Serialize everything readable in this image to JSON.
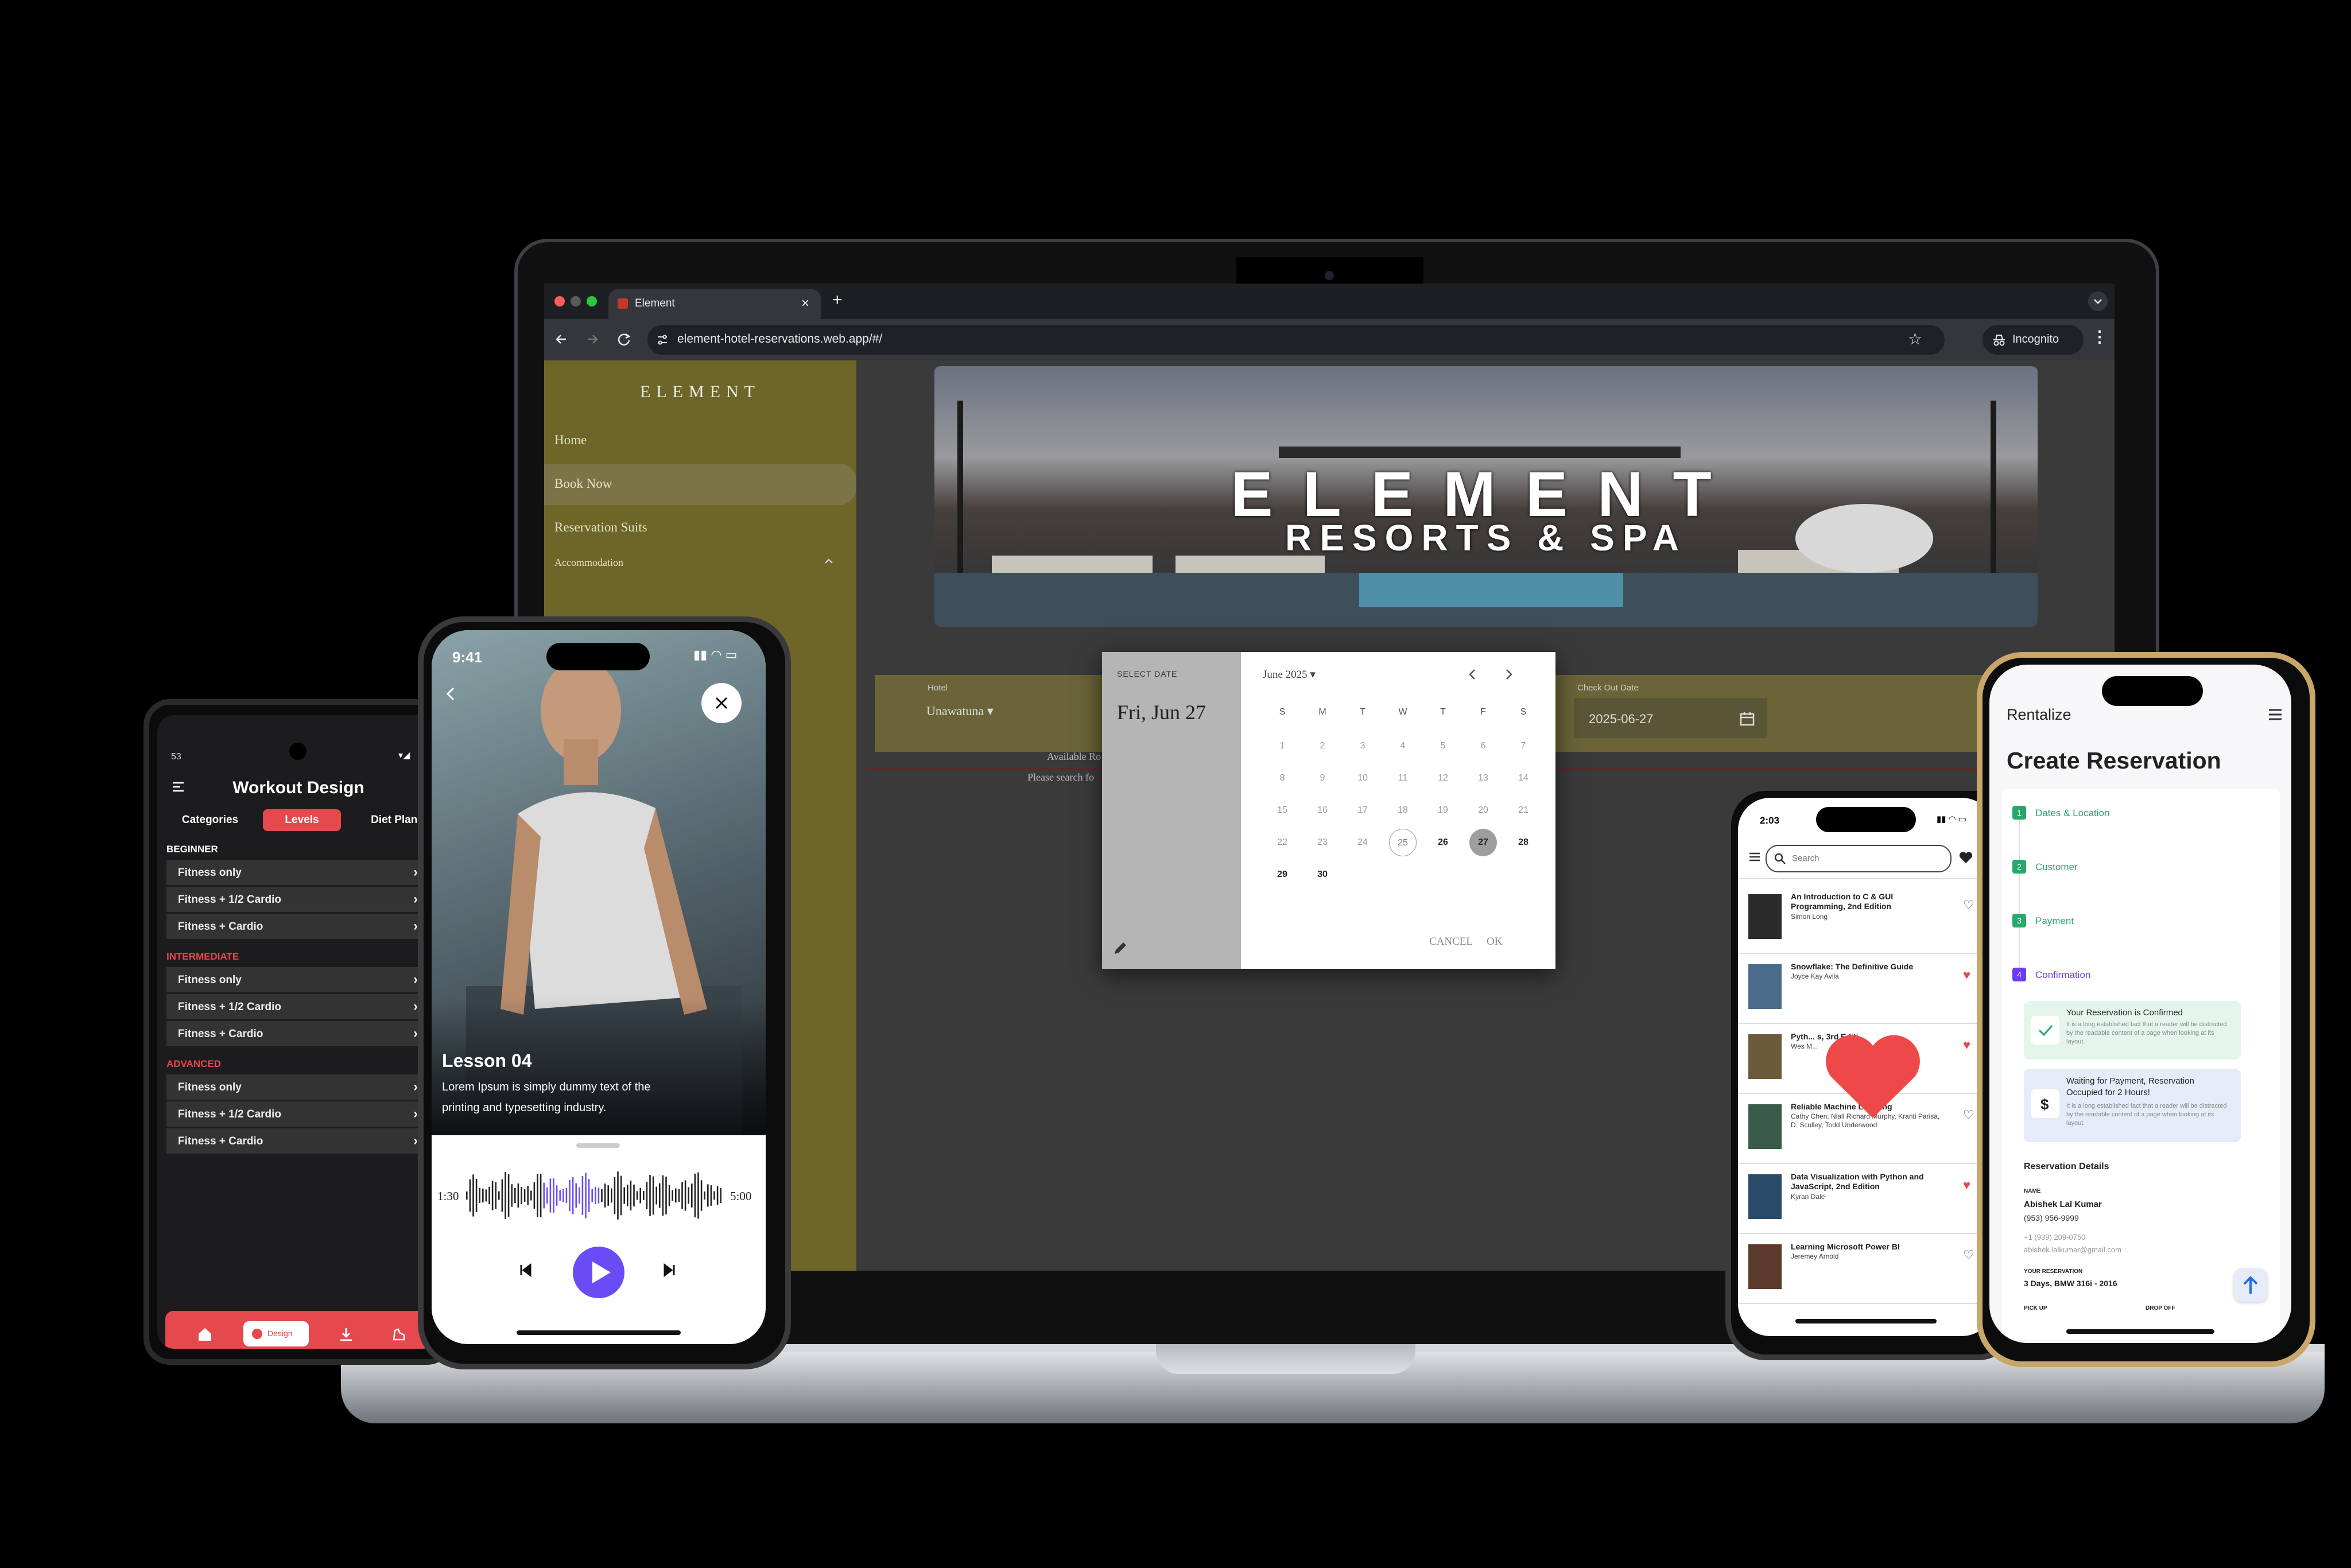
{
  "laptop": {
    "browser": {
      "tab_title": "Element",
      "url": "element-hotel-reservations.web.app/#/",
      "incognito_label": "Incognito",
      "new_tab_symbol": "+",
      "tab_close_symbol": "×"
    },
    "site": {
      "brand": "ELEMENT",
      "nav": [
        {
          "label": "Home"
        },
        {
          "label": "Book Now"
        },
        {
          "label": "Reservation Suits"
        },
        {
          "label": "Accommodation"
        }
      ],
      "banner": {
        "title": "ELEMENT",
        "subtitle": "RESORTS & SPA"
      },
      "form": {
        "hotel_label": "Hotel",
        "hotel_value": "Unawatuna",
        "checkout_label": "Check Out Date",
        "checkout_value": "2025-06-27",
        "available_text": "Available Ro",
        "search_hint": "Please search fo"
      }
    },
    "datepicker": {
      "header_label": "SELECT DATE",
      "selected_date": "Fri, Jun 27",
      "month_label": "June 2025",
      "weekdays": [
        "S",
        "M",
        "T",
        "W",
        "T",
        "F",
        "S"
      ],
      "weeks": [
        [
          "1",
          "2",
          "3",
          "4",
          "5",
          "6",
          "7"
        ],
        [
          "8",
          "9",
          "10",
          "11",
          "12",
          "13",
          "14"
        ],
        [
          "15",
          "16",
          "17",
          "18",
          "19",
          "20",
          "21"
        ],
        [
          "22",
          "23",
          "24",
          "25",
          "26",
          "27",
          "28"
        ],
        [
          "29",
          "30",
          "",
          "",
          "",
          "",
          ""
        ]
      ],
      "today": "25",
      "selected": "27",
      "cancel_label": "CANCEL",
      "ok_label": "OK"
    }
  },
  "workout_phone": {
    "status_time": "53",
    "title": "Workout Design",
    "tabs": [
      "Categories",
      "Levels",
      "Diet Plans"
    ],
    "active_tab": "Levels",
    "sections": [
      {
        "title": "BEGINNER",
        "items": [
          "Fitness only",
          "Fitness + 1/2 Cardio",
          "Fitness + Cardio"
        ]
      },
      {
        "title": "INTERMEDIATE",
        "items": [
          "Fitness only",
          "Fitness + 1/2 Cardio",
          "Fitness + Cardio"
        ]
      },
      {
        "title": "ADVANCED",
        "items": [
          "Fitness only",
          "Fitness + 1/2 Cardio",
          "Fitness + Cardio"
        ]
      }
    ],
    "bottom_nav_active_label": "Design",
    "accent": "#e5484d"
  },
  "lesson_phone": {
    "status_time": "9:41",
    "lesson_title": "Lesson 04",
    "lesson_desc": "Lorem Ipsum is simply dummy text of the printing and typesetting industry.",
    "time_elapsed": "1:30",
    "time_total": "5:00",
    "playback_progress": 0.3,
    "accent": "#6a4cf5"
  },
  "books_phone": {
    "status_time": "2:03",
    "search_placeholder": "Search",
    "books": [
      {
        "title": "An Introduction to C & GUI Programming, 2nd Edition",
        "author": "Simon Long",
        "favorite": false
      },
      {
        "title": "Snowflake: The Definitive Guide",
        "author": "Joyce Kay Avila",
        "favorite": true
      },
      {
        "title": "Pyth... s, 3rd Editi...",
        "author": "Wes M...",
        "favorite": true
      },
      {
        "title": "Reliable Machine Learning",
        "author": "Cathy Chen, Niall Richard Murphy, Kranti Parisa, D. Sculley, Todd Underwood",
        "favorite": false
      },
      {
        "title": "Data Visualization with Python and JavaScript, 2nd Edition",
        "author": "Kyran Dale",
        "favorite": true
      },
      {
        "title": "Learning Microsoft Power BI",
        "author": "Jeremey Arnold",
        "favorite": false
      }
    ]
  },
  "rentalize_phone": {
    "app_name": "Rentalize",
    "title": "Create Reservation",
    "steps": [
      {
        "num": "1",
        "label": "Dates & Location"
      },
      {
        "num": "2",
        "label": "Customer"
      },
      {
        "num": "3",
        "label": "Payment"
      },
      {
        "num": "4",
        "label": "Confirmation"
      }
    ],
    "confirmed_title": "Your Reservation is Confirmed",
    "confirmed_text": "It is a long established fact that a reader will be distracted by the readable content of a page when looking at its layout.",
    "waiting_title": "Waiting for Payment, Reservation Occupied for 2 Hours!",
    "waiting_text": "It is a long established fact that a reader will be distracted by the readable content of a page when looking at its layout.",
    "details_title": "Reservation Details",
    "name_label": "NAME",
    "name_value": "Abishek Lal Kumar",
    "phone1": "(953) 956-9999",
    "phone2": "+1 (939) 209-0750",
    "email": "abishek.lalkumar@gmail.com",
    "your_res_label": "YOUR RESERVATION",
    "your_res_value": "3 Days, BMW 316i - 2016",
    "pickup_label": "PICK UP",
    "dropoff_label": "DROP OFF",
    "accent_green": "#27a86b",
    "accent_purple": "#6c3cf0"
  }
}
